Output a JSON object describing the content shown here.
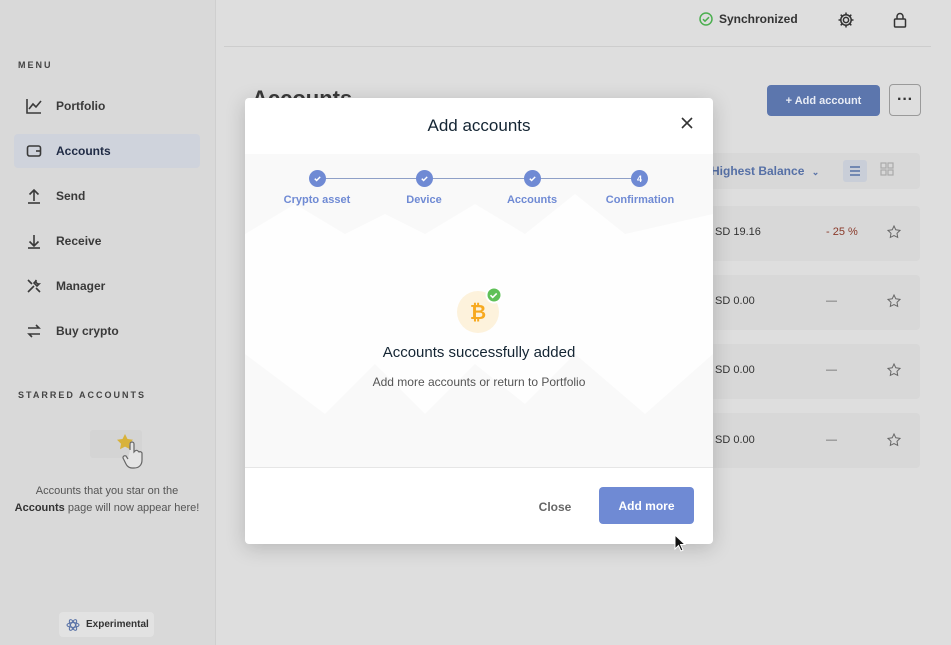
{
  "window": {
    "traffic_colors": [
      "#e35d5b",
      "#e6b13a",
      "#4fb74b"
    ]
  },
  "sidebar": {
    "menu_title": "MENU",
    "items": [
      {
        "label": "Portfolio",
        "icon": "chart-line-icon",
        "active": false
      },
      {
        "label": "Accounts",
        "icon": "wallet-icon",
        "active": true
      },
      {
        "label": "Send",
        "icon": "arrow-up-icon",
        "active": false
      },
      {
        "label": "Receive",
        "icon": "arrow-down-icon",
        "active": false
      },
      {
        "label": "Manager",
        "icon": "tools-icon",
        "active": false
      },
      {
        "label": "Buy crypto",
        "icon": "exchange-icon",
        "active": false
      }
    ],
    "starred_title": "STARRED ACCOUNTS",
    "starred_text_1": "Accounts that you star on the",
    "starred_text_bold": "Accounts",
    "starred_text_2": "page will now appear here!",
    "experimental_label": "Experimental"
  },
  "topbar": {
    "sync_label": "Synchronized",
    "sync_color": "#4caf50"
  },
  "main": {
    "page_title": "Accounts",
    "add_account_label": "+ Add account",
    "more_label": "···",
    "sort_label": "Highest Balance",
    "accounts": [
      {
        "balance": "SD 19.16",
        "change": "- 25 %"
      },
      {
        "balance": "SD 0.00",
        "change": "—"
      },
      {
        "balance": "SD 0.00",
        "change": "—"
      },
      {
        "balance": "SD 0.00",
        "change": "—"
      }
    ]
  },
  "modal": {
    "title": "Add accounts",
    "steps": [
      {
        "label": "Crypto asset",
        "state": "done"
      },
      {
        "label": "Device",
        "state": "done"
      },
      {
        "label": "Accounts",
        "state": "done"
      },
      {
        "label": "Confirmation",
        "state": "current",
        "number": "4"
      }
    ],
    "success_title": "Accounts successfully added",
    "success_subtitle": "Add more accounts or return to Portfolio",
    "close_label": "Close",
    "add_more_label": "Add more",
    "accent_color": "#6f8ad4",
    "bitcoin_color": "#f7a91f"
  }
}
